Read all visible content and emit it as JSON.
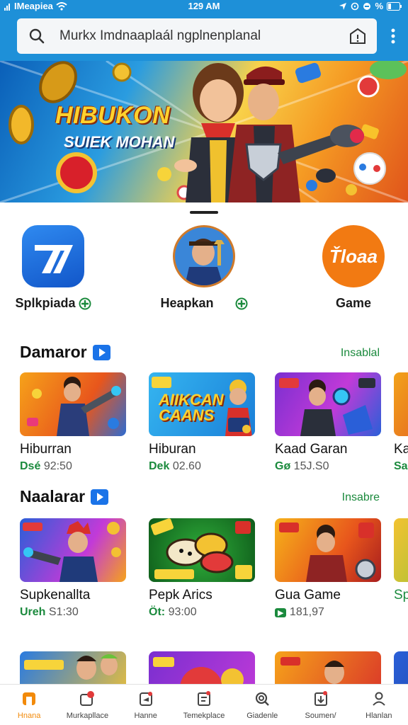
{
  "status_bar": {
    "carrier": "IMeapiea",
    "time": "129 AM",
    "battery": "%"
  },
  "search": {
    "text": "Murkx Imdnaaplaál ngplnenplanal"
  },
  "banner": {
    "title": "HIBUKON",
    "subtitle": "SUIEK MOHAN"
  },
  "top_apps": [
    {
      "label": "Splkpiada",
      "tile_text": "7",
      "badge": true
    },
    {
      "label": "Heapkan",
      "tile_text": "",
      "badge": true
    },
    {
      "label": "Game",
      "tile_text": "Ťloaa",
      "badge": false
    }
  ],
  "sections": [
    {
      "title": "Damaror",
      "link": "Insablal",
      "cards": [
        {
          "title": "Hiburran",
          "tag": "Dsé",
          "value": "92:50",
          "thumb_text": ""
        },
        {
          "title": "Hiburan",
          "tag": "Dek",
          "value": "02.60",
          "thumb_text": "AIIKCAN CAANS"
        },
        {
          "title": "Kaad Garan",
          "tag": "Gø",
          "value": "15J.S0",
          "thumb_text": ""
        },
        {
          "title": "Ka",
          "tag": "Sal",
          "value": "",
          "thumb_text": ""
        }
      ]
    },
    {
      "title": "Naalarar",
      "link": "Insabre",
      "cards": [
        {
          "title": "Supkenallta",
          "tag": "Ureh",
          "value": "S1:30",
          "thumb_text": ""
        },
        {
          "title": "Pepk Arics",
          "tag": "Öt:",
          "value": "93:00",
          "thumb_text": ""
        },
        {
          "title": "Gua Game",
          "tag": "▶",
          "value": "181,97",
          "thumb_text": ""
        },
        {
          "title": "Sp",
          "tag": "",
          "value": "",
          "thumb_text": ""
        }
      ]
    }
  ],
  "bottom_nav": [
    {
      "label": "Hnana",
      "icon": "home-icon",
      "active": true
    },
    {
      "label": "Murkapllace",
      "icon": "marketplace-icon",
      "active": false
    },
    {
      "label": "Hanne",
      "icon": "news-icon",
      "active": false
    },
    {
      "label": "Temekplace",
      "icon": "apps-icon",
      "active": false
    },
    {
      "label": "Giadenle",
      "icon": "search-icon",
      "active": false
    },
    {
      "label": "Soumen/",
      "icon": "download-icon",
      "active": false
    },
    {
      "label": "Hlanlan",
      "icon": "person-icon",
      "active": false
    }
  ],
  "colors": {
    "header": "#1e90d8",
    "accent_green": "#1b8a3d",
    "active_nav": "#f28a0a",
    "play_badge": "#1a73e8"
  }
}
